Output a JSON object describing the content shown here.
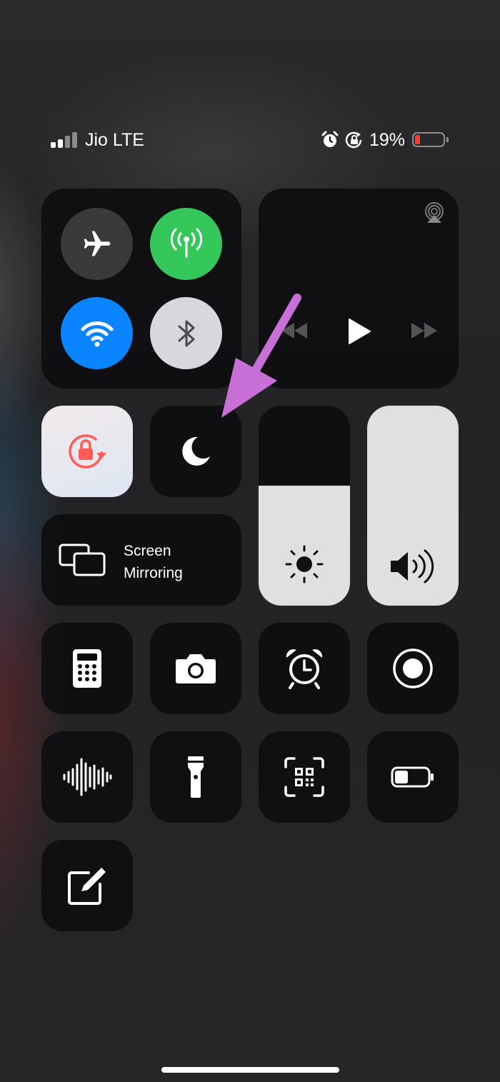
{
  "status_bar": {
    "carrier": "Jio LTE",
    "battery_percent": "19%",
    "battery_level": 0.19,
    "signal_bars": 2,
    "icons": [
      "alarm-icon",
      "rotation-lock-icon"
    ]
  },
  "connectivity": {
    "airplane_mode": false,
    "cellular_data": true,
    "wifi": true,
    "bluetooth": false
  },
  "media": {
    "controls": [
      "previous-icon",
      "play-icon",
      "next-icon"
    ],
    "airplay_icon": "airplay-icon"
  },
  "toggles": {
    "orientation_lock": true,
    "do_not_disturb": false
  },
  "screen_mirroring": {
    "label_line1": "Screen",
    "label_line2": "Mirroring"
  },
  "sliders": {
    "brightness_level": 0.6,
    "volume_level": 1.0
  },
  "shortcuts": [
    "calculator-icon",
    "camera-icon",
    "alarm-clock-icon",
    "screen-record-icon",
    "voice-memos-icon",
    "flashlight-icon",
    "qr-scanner-icon",
    "low-power-icon",
    "notes-icon"
  ],
  "annotation": {
    "arrow_color": "#c86fd8"
  },
  "colors": {
    "cellular_green": "#34c759",
    "wifi_blue": "#0a84ff",
    "battery_red": "#ff3b30",
    "orientation_red": "#ff5a55"
  }
}
